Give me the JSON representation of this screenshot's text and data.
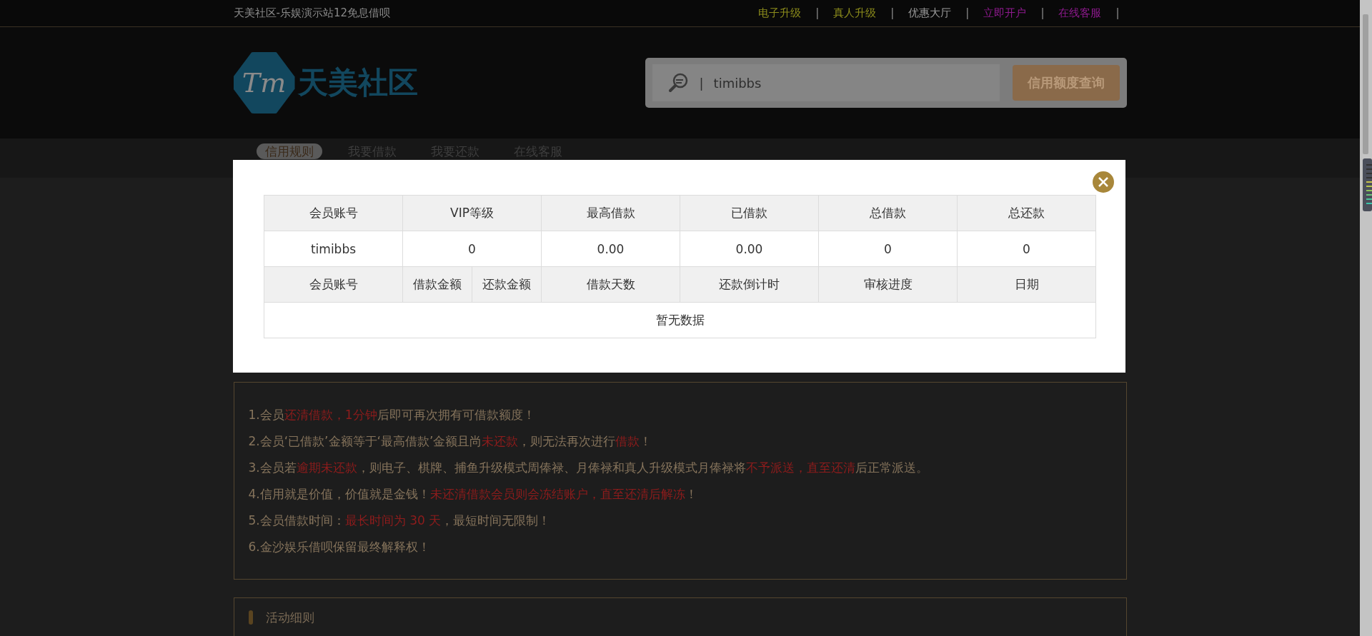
{
  "top_bar": {
    "title": "天美社区-乐娱演示站12免息借呗",
    "links": [
      {
        "label": "电子升级",
        "color": "#8c8c1c",
        "separator": "|"
      },
      {
        "label": "真人升级",
        "color": "#8c8c1c",
        "separator": "|"
      },
      {
        "label": "优惠大厅",
        "color": "#9a9a9a",
        "separator": "|"
      },
      {
        "label": "立即开户",
        "color": "#8e1a8e",
        "separator": "|"
      },
      {
        "label": "在线客服",
        "color": "#8e1a8e",
        "separator": "|"
      }
    ]
  },
  "header": {
    "logo_mark": "Tm",
    "logo_text": "天美社区",
    "search": {
      "divider": "|",
      "value": "timibbs"
    },
    "query_button": "信用额度查询"
  },
  "nav": [
    {
      "label": "信用规则",
      "selected": true
    },
    {
      "label": "我要借款",
      "selected": false
    },
    {
      "label": "我要还款",
      "selected": false
    },
    {
      "label": "在线客服",
      "selected": false
    }
  ],
  "modal": {
    "summary": {
      "columns": [
        "会员账号",
        "VIP等级",
        "最高借款",
        "已借款",
        "总借款",
        "总还款"
      ],
      "values": [
        "timibbs",
        "0",
        "0.00",
        "0.00",
        "0",
        "0"
      ]
    },
    "records": {
      "columns": [
        "会员账号",
        "借款金额",
        "还款金额",
        "借款天数",
        "还款倒计时",
        "审核进度",
        "日期"
      ],
      "empty_text": "暂无数据"
    }
  },
  "rules": [
    [
      {
        "text": "1.会员",
        "highlight": false
      },
      {
        "text": "还清借款，1分钟",
        "highlight": true
      },
      {
        "text": "后即可再次拥有可借款额度！",
        "highlight": false
      }
    ],
    [
      {
        "text": "2.会员‘已借款’金额等于‘最高借款’金额且尚",
        "highlight": false
      },
      {
        "text": "未还款",
        "highlight": true
      },
      {
        "text": "，则无法再次进行",
        "highlight": false
      },
      {
        "text": "借款",
        "highlight": true
      },
      {
        "text": "！",
        "highlight": false
      }
    ],
    [
      {
        "text": "3.会员若",
        "highlight": false
      },
      {
        "text": "逾期未还款",
        "highlight": true
      },
      {
        "text": "，则电子、棋牌、捕鱼升级模式周俸禄、月俸禄和真人升级模式月俸禄将",
        "highlight": false
      },
      {
        "text": "不予派送，直至还清",
        "highlight": true
      },
      {
        "text": "后正常派送。",
        "highlight": false
      }
    ],
    [
      {
        "text": "4.信用就是价值，价值就是金钱！",
        "highlight": false
      },
      {
        "text": "未还清借款会员则会冻结账户，直至还清后解冻",
        "highlight": true
      },
      {
        "text": "！",
        "highlight": false
      }
    ],
    [
      {
        "text": "5.会员借款时间：",
        "highlight": false
      },
      {
        "text": "最长时间为 30 天",
        "highlight": true
      },
      {
        "text": "，最短时间无限制！",
        "highlight": false
      }
    ],
    [
      {
        "text": "6.金沙娱乐借呗保留最终解释权！",
        "highlight": false
      }
    ]
  ],
  "activity_panel": {
    "title": "活动细则"
  }
}
